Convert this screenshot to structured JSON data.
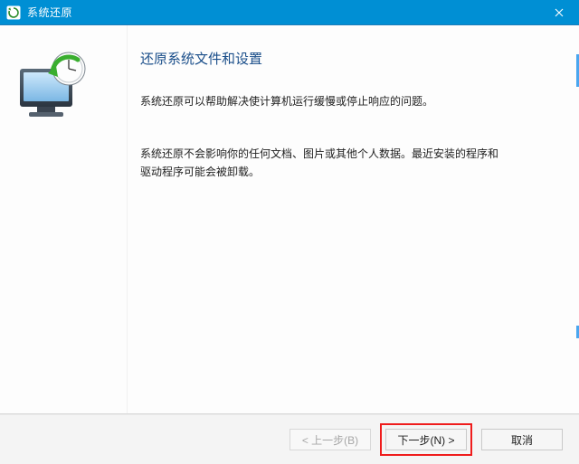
{
  "titlebar": {
    "title": "系统还原"
  },
  "content": {
    "heading": "还原系统文件和设置",
    "para1": "系统还原可以帮助解决使计算机运行缓慢或停止响应的问题。",
    "para2": "系统还原不会影响你的任何文档、图片或其他个人数据。最近安装的程序和驱动程序可能会被卸载。"
  },
  "footer": {
    "back": "< 上一步(B)",
    "next": "下一步(N) >",
    "cancel": "取消"
  },
  "colors": {
    "titlebar_bg": "#008fd4",
    "accent": "#4aa6ef",
    "heading_color": "#1a4e8a",
    "highlight_border": "#ef1c1c"
  }
}
